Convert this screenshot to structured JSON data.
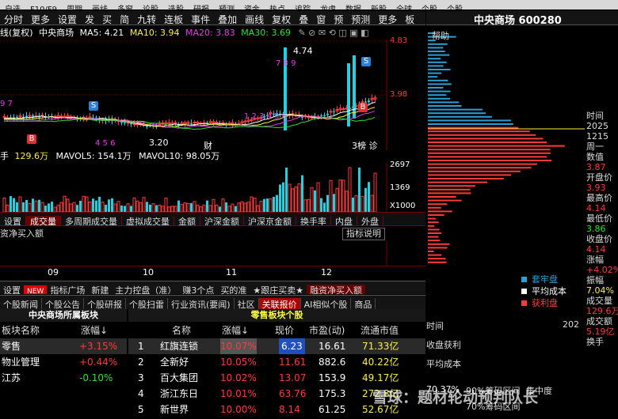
{
  "top_menu": [
    "自选",
    "F10/F9",
    "周期",
    "画线",
    "多窗",
    "论股",
    "选股",
    "研报",
    "预测",
    "资金",
    "热点",
    "追踪",
    "龙虎",
    "数据",
    "新股",
    "全球",
    "个股",
    "个股"
  ],
  "toolbar": [
    "分时",
    "更多",
    "设置",
    "发",
    "买",
    "简",
    "九转",
    "连板",
    "事件",
    "叠加",
    "画线",
    "复权",
    "叠",
    "窗",
    "预",
    "预测",
    "更多",
    "板"
  ],
  "stock_title": "中央商场 600280",
  "indicator_line": {
    "prefix": "线(复权)",
    "name": "中央商场",
    "ma5": "MA5: 4.21",
    "ma10": "MA10: 3.94",
    "ma20": "MA20: 3.83",
    "ma30": "MA30: 3.69"
  },
  "chart_labels": {
    "price_high": "4.83",
    "price_mid": "3.98",
    "peak": "4.74",
    "low": "3.20",
    "event_tag": "财",
    "tag_list": "3榜 诊",
    "seq_left": "9 7",
    "seq_mid": "1 2 3 4 5 6",
    "seq_low": "4 5 6",
    "seq_num": "7 8 9",
    "b_mark": "B",
    "s_mark": "S"
  },
  "volume_line": {
    "prefix": "手",
    "vol": "129.6万",
    "mavol5": "MAVOL5: 154.1万",
    "mavol10": "MAVOL10: 98.05万"
  },
  "volume_axis": {
    "v1": "2697",
    "v2": "1369",
    "unit": "X1000"
  },
  "tabs_indicators": [
    "设置",
    "成交量",
    "多周期成交量",
    "虚拟成交量",
    "金额",
    "沪深金额",
    "沪深京金额",
    "换手率",
    "内盘",
    "外盘"
  ],
  "sub_indicator": {
    "name": "资净买入额",
    "help": "指标说明"
  },
  "date_axis": [
    "09",
    "10",
    "11",
    "12"
  ],
  "tabs_tools": [
    "设置",
    "NEW",
    "指标广场",
    "新建",
    "主力控盘（准）",
    "赚3个点",
    "买的准",
    "★跟庄买卖★",
    "融资净买入额"
  ],
  "tabs_news": [
    "个股新闻",
    "个股公告",
    "个股研报",
    "个股扫雷",
    "行业资讯(要闻)",
    "社区",
    "关联报价",
    "AI相似个股",
    "商品"
  ],
  "sector_title": "中央商场所属板块",
  "stock_title_right": "零售板块个股",
  "sector_header": {
    "name": "板块名称",
    "chg": "涨幅↓"
  },
  "sectors": [
    {
      "name": "零售",
      "chg": "+3.15%",
      "color": "#ff3a3a"
    },
    {
      "name": "物业管理",
      "chg": "+0.44%",
      "color": "#ff3a3a"
    },
    {
      "name": "江苏",
      "chg": "-0.10%",
      "color": "#2ee02e"
    }
  ],
  "stock_header": {
    "name": "名称",
    "chg": "涨幅↓",
    "price": "现价",
    "pe": "市盈(动)",
    "cap": "流通市值"
  },
  "stocks": [
    {
      "no": "1",
      "name": "红旗连锁",
      "chg": "10.07%",
      "price": "6.23",
      "pe": "16.61",
      "cap": "71.33亿"
    },
    {
      "no": "2",
      "name": "全新好",
      "chg": "10.05%",
      "price": "11.61",
      "pe": "882.6",
      "cap": "40.22亿"
    },
    {
      "no": "3",
      "name": "百大集团",
      "chg": "10.02%",
      "price": "13.07",
      "pe": "153.9",
      "cap": "49.17亿"
    },
    {
      "no": "4",
      "name": "浙江东日",
      "chg": "10.01%",
      "price": "63.76",
      "pe": "175.3",
      "cap": "272.8亿"
    },
    {
      "no": "5",
      "name": "新世界",
      "chg": "10.00%",
      "price": "8.14",
      "pe": "61.25",
      "cap": "52.67亿"
    }
  ],
  "right_panel": {
    "help": "帮助",
    "legend": [
      {
        "label": "套牢盘",
        "color": "#2a9fd6"
      },
      {
        "label": "平均成本",
        "color": "#ffffff"
      },
      {
        "label": "获利盘",
        "color": "#ff3a3a"
      }
    ],
    "time_label": "时间",
    "time_value": "202",
    "profit_label": "收盘获利",
    "avgcost_label": "平均成本",
    "pct": "70.37%",
    "concentration": "90%筹码区间",
    "concentration2": "集中度",
    "share": "70%筹码区间"
  },
  "info": [
    {
      "k": "时间",
      "v": ""
    },
    {
      "k": "2025",
      "v": ""
    },
    {
      "k": "1215",
      "v": ""
    },
    {
      "k": "周一",
      "v": ""
    },
    {
      "k": "数值",
      "v": "3.87"
    },
    {
      "k": "开盘价",
      "v": "3.93"
    },
    {
      "k": "最高价",
      "v": "4.14"
    },
    {
      "k": "最低价",
      "v": "3.86"
    },
    {
      "k": "收盘价",
      "v": "4.14"
    },
    {
      "k": "涨幅",
      "v": "+4.02%"
    },
    {
      "k": "振幅",
      "v": "7.04%"
    },
    {
      "k": "成交量",
      "v": "129.6万"
    },
    {
      "k": "成交额",
      "v": "5.19亿"
    },
    {
      "k": "换手",
      "v": ""
    }
  ],
  "watermark": "雪球：题材轮动预判队长"
}
